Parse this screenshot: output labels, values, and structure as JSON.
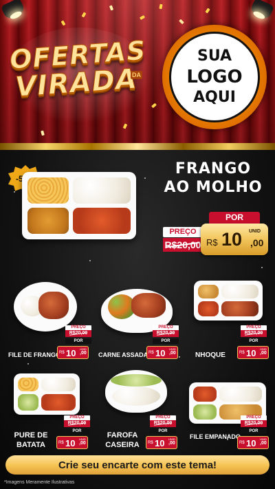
{
  "header": {
    "title_line1": "OFERTAS",
    "title_line2": "VIRADA",
    "title_small": "DA",
    "logo_line1": "SUA",
    "logo_line2": "LOGO",
    "logo_line3": "AQUI"
  },
  "featured": {
    "badge": "-50%",
    "name_line1": "FRANGO",
    "name_line2": "AO MOLHO",
    "price_label": "PREÇO",
    "old_price": "R$20,00",
    "por_label": "POR",
    "currency": "R$",
    "price_int": "10",
    "price_dec": ",00",
    "unit": "UNID"
  },
  "products": [
    {
      "name": "FILE DE FRANGO",
      "price_label": "PREÇO",
      "old_price": "R$20,00",
      "por_label": "POR",
      "currency": "R$",
      "price_int": "10",
      "price_dec": ",00",
      "unit": "UNID"
    },
    {
      "name": "CARNE ASSADA",
      "price_label": "PREÇO",
      "old_price": "R$20,00",
      "por_label": "POR",
      "currency": "R$",
      "price_int": "10",
      "price_dec": ",00",
      "unit": "UNID"
    },
    {
      "name": "NHOQUE",
      "price_label": "PREÇO",
      "old_price": "R$20,00",
      "por_label": "POR",
      "currency": "R$",
      "price_int": "10",
      "price_dec": ",00",
      "unit": "UNID"
    },
    {
      "name_line1": "PURE DE",
      "name_line2": "BATATA",
      "price_label": "PREÇO",
      "old_price": "R$20,00",
      "por_label": "POR",
      "currency": "R$",
      "price_int": "10",
      "price_dec": ",00",
      "unit": "UNID"
    },
    {
      "name_line1": "FAROFA",
      "name_line2": "CASEIRA",
      "price_label": "PREÇO",
      "old_price": "R$20,00",
      "por_label": "POR",
      "currency": "R$",
      "price_int": "10",
      "price_dec": ",00",
      "unit": "UNID"
    },
    {
      "name": "FILE EMPANADO",
      "price_label": "PREÇO",
      "old_price": "R$20,00",
      "por_label": "POR",
      "currency": "R$",
      "price_int": "10",
      "price_dec": ",00",
      "unit": "UNID"
    }
  ],
  "cta": "Crie seu encarte com este tema!",
  "disclaimer": "*Imagens Meramente Ilustrativas",
  "colors": {
    "curtain_red": "#b3161a",
    "price_red": "#c8102e",
    "gold": "#f1c55b",
    "background": "#0d0d0d"
  }
}
